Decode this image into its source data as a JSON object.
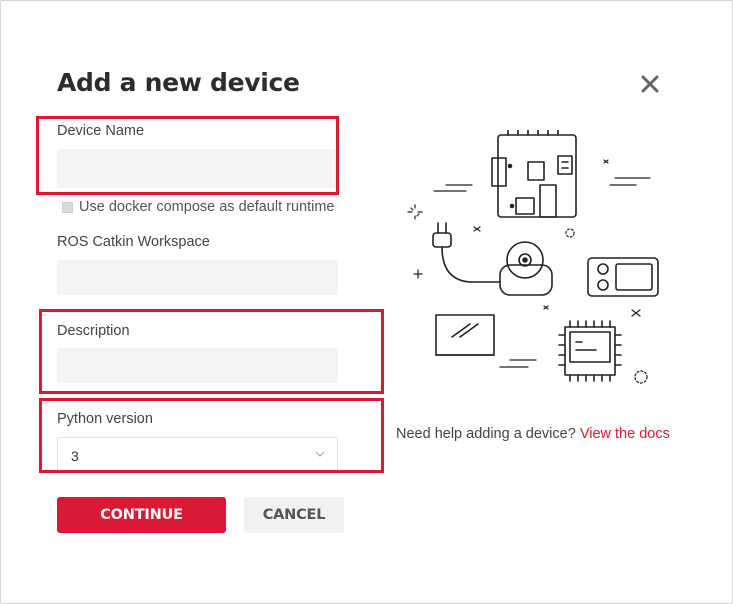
{
  "dialog": {
    "title": "Add a new device",
    "close_icon": "close-icon"
  },
  "form": {
    "device_name": {
      "label": "Device Name",
      "value": "",
      "placeholder": ""
    },
    "docker_compose": {
      "label": "Use docker compose as default runtime",
      "checked": false
    },
    "catkin_workspace": {
      "label": "ROS Catkin Workspace",
      "value": "",
      "placeholder": ""
    },
    "description": {
      "label": "Description",
      "value": "",
      "placeholder": ""
    },
    "python_version": {
      "label": "Python version",
      "selected": "3"
    }
  },
  "actions": {
    "continue_label": "CONTINUE",
    "cancel_label": "CANCEL"
  },
  "help": {
    "text": "Need help adding a device?",
    "link_text": "View the docs"
  },
  "colors": {
    "accent": "#d91a34",
    "highlight": "#e0182f",
    "field_bg": "#f4f4f4"
  },
  "illustration": {
    "name": "devices-illustration"
  }
}
